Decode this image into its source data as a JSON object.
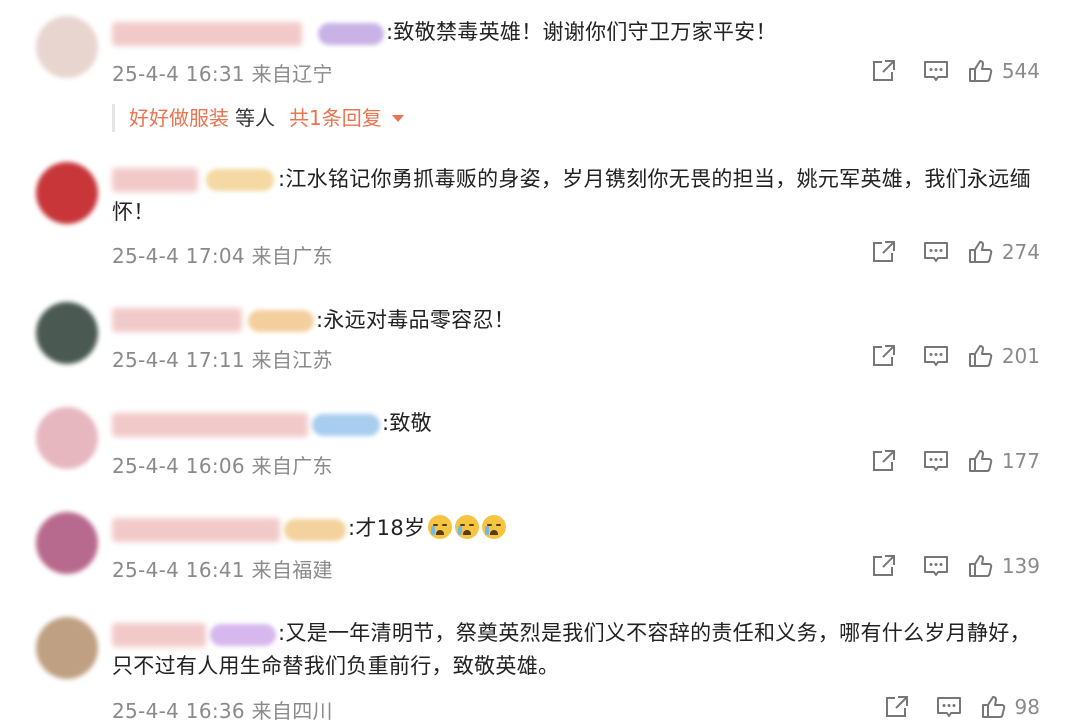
{
  "comments": [
    {
      "text": ":致敬禁毒英雄！谢谢你们守卫万家平安！",
      "time": "25-4-4 16:31",
      "location": "来自辽宁",
      "likes": "544",
      "avatar_color": "#e8d5cf",
      "badge_color": "#c9b3e6",
      "reply": {
        "name": "好好做服装",
        "middle": "等人",
        "count": "共1条回复"
      }
    },
    {
      "text": ":江水铭记你勇抓毒贩的身姿，岁月镌刻你无畏的担当，姚元军英雄，我们永远缅怀！",
      "time": "25-4-4 17:04",
      "location": "来自广东",
      "likes": "274",
      "avatar_color": "#c8363a",
      "badge_color": "#f4d9a2"
    },
    {
      "text": ":永远对毒品零容忍！",
      "time": "25-4-4 17:11",
      "location": "来自江苏",
      "likes": "201",
      "avatar_color": "#4a5a52",
      "badge_color": "#f4cf9e"
    },
    {
      "text": ":致敬",
      "time": "25-4-4 16:06",
      "location": "来自广东",
      "likes": "177",
      "avatar_color": "#e7b7c0",
      "badge_color": "#a9cdee"
    },
    {
      "text": ":才18岁",
      "time": "25-4-4 16:41",
      "location": "来自福建",
      "likes": "139",
      "avatar_color": "#b86a8e",
      "badge_color": "#f4d29e"
    },
    {
      "text": ":又是一年清明节，祭奠英烈是我们义不容辞的责任和义务，哪有什么岁月静好，只不过有人用生命替我们负重前行，致敬英雄。",
      "time": "25-4-4 16:36",
      "location": "来自四川",
      "likes": "98",
      "avatar_color": "#bfa082",
      "badge_color": "#d7b8ee"
    }
  ],
  "colors": {
    "accent": "#eb7350",
    "meta": "#8a8a8a",
    "text": "#222222"
  }
}
